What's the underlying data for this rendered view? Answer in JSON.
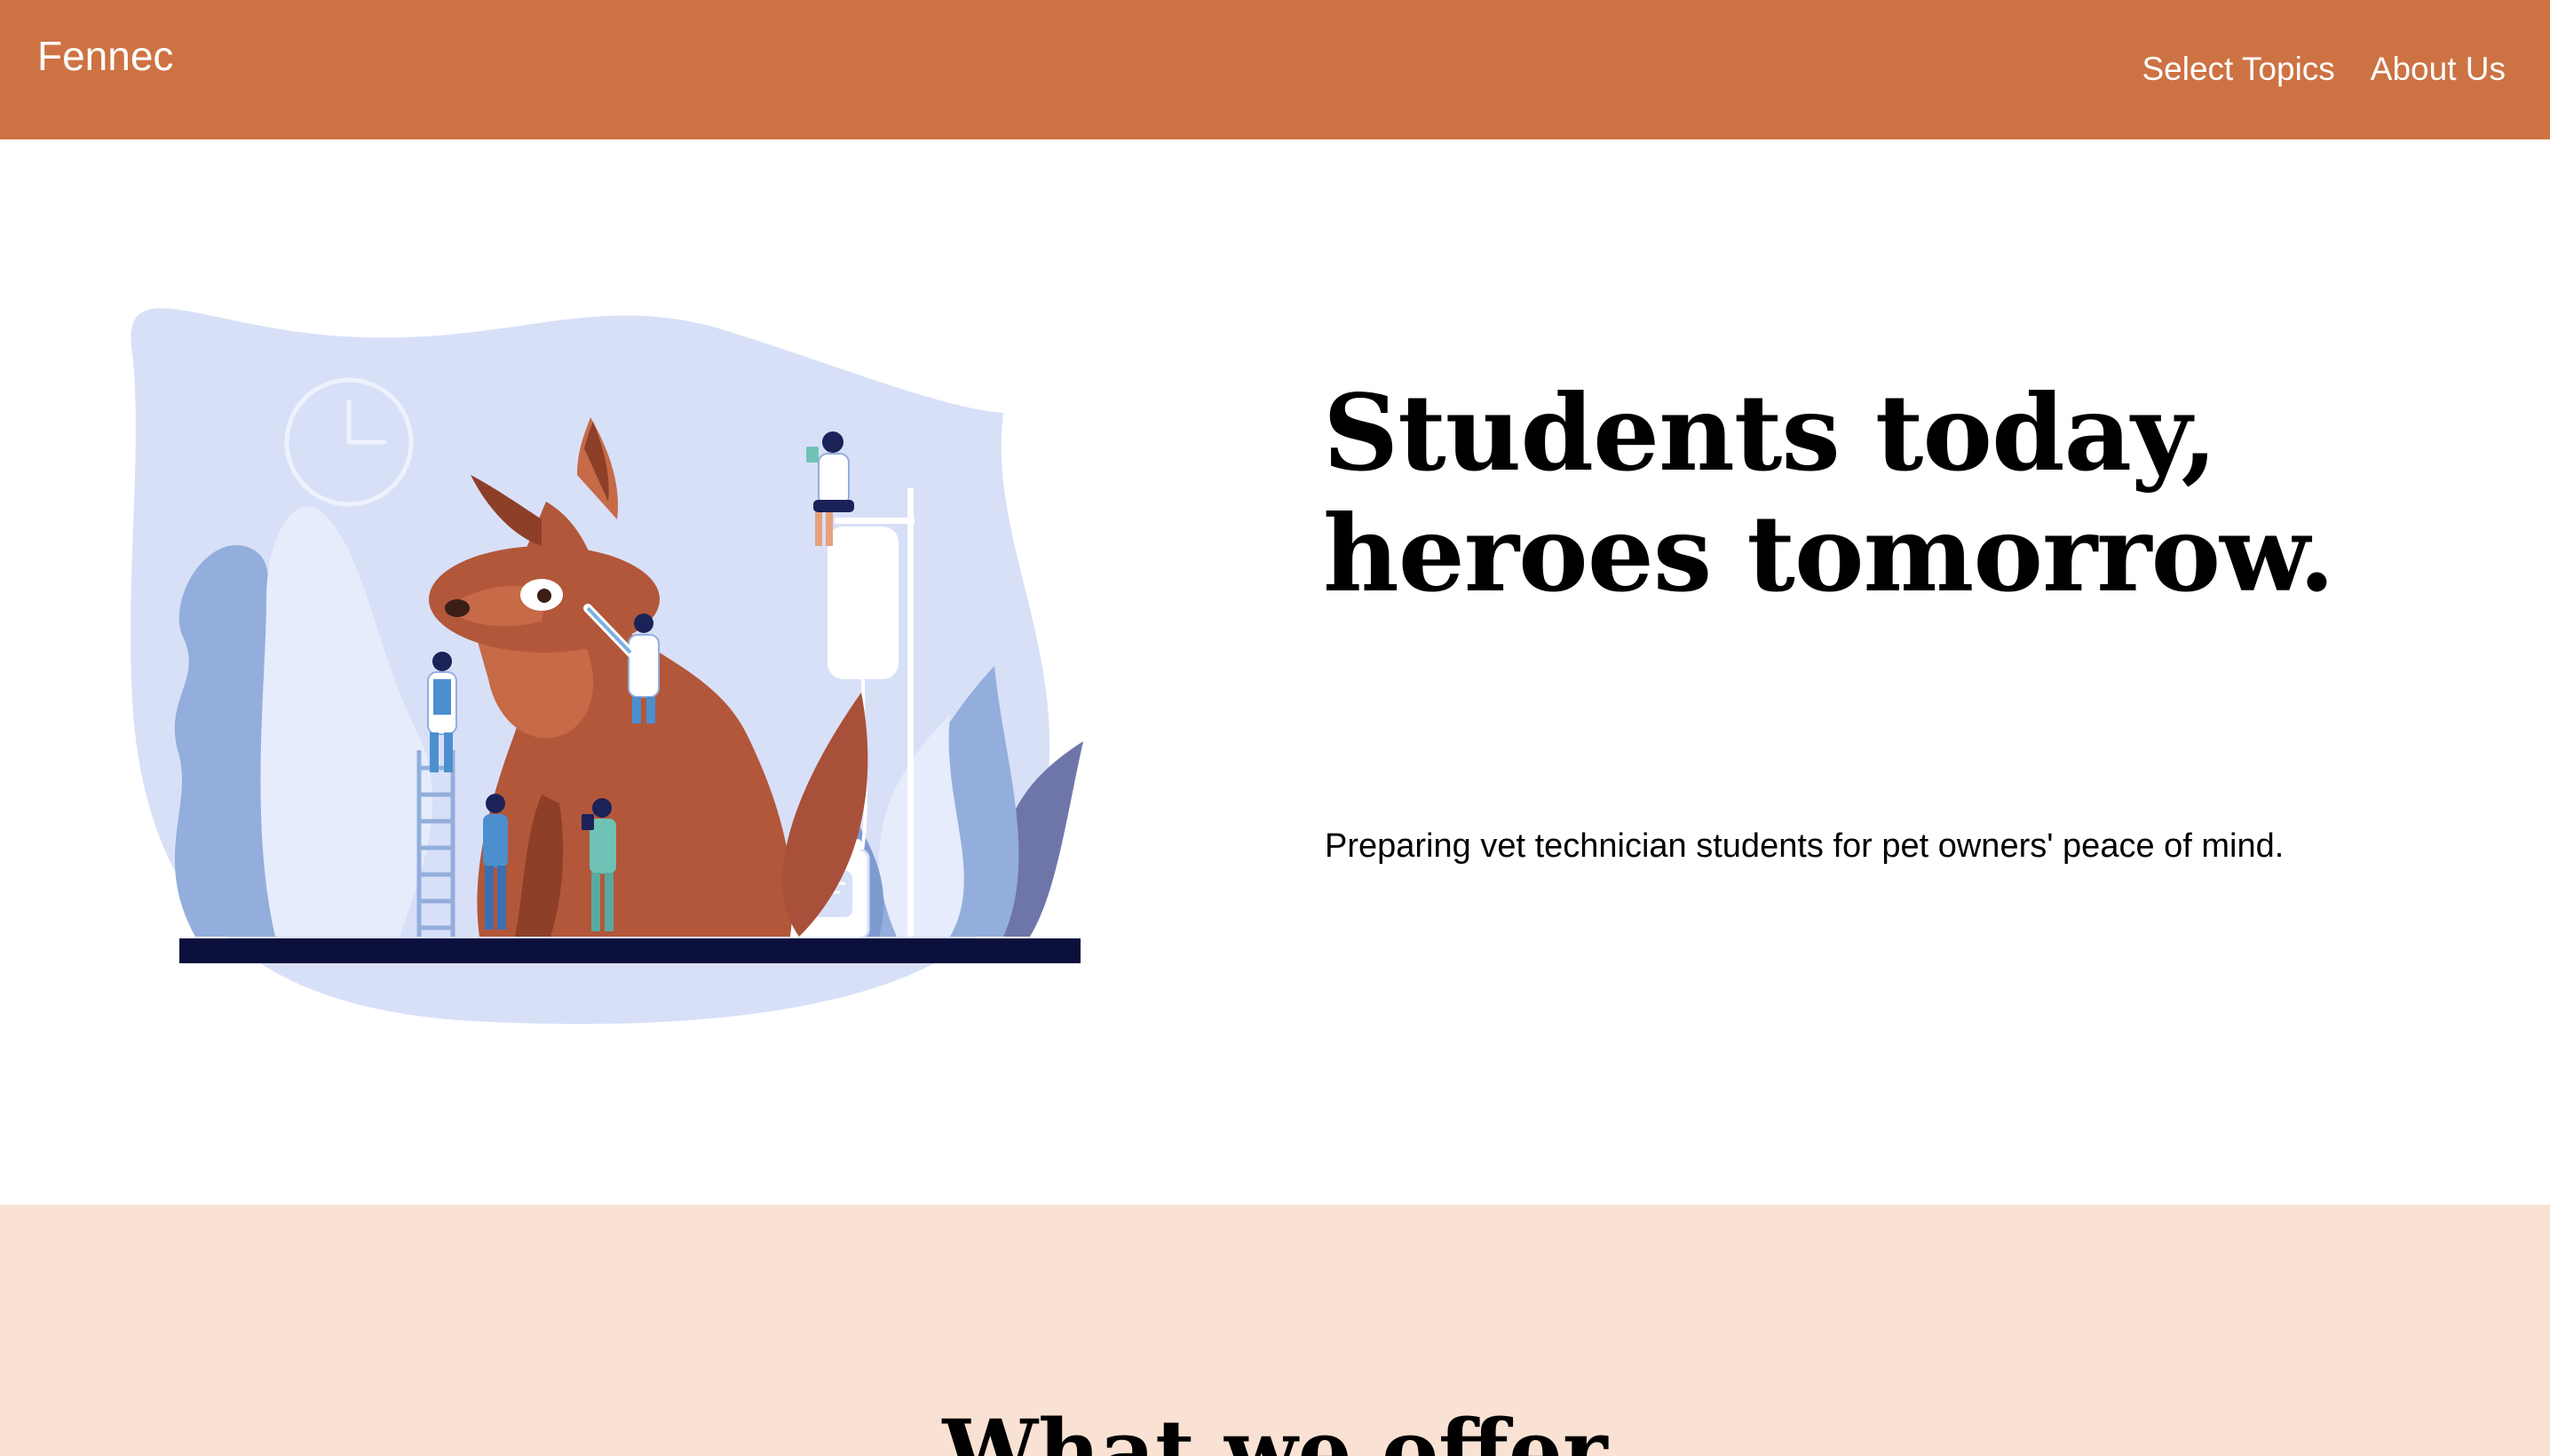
{
  "navbar": {
    "brand": "Fennec",
    "links": [
      "Select Topics",
      "About Us"
    ],
    "color": "#cd7243"
  },
  "hero": {
    "title_line1": "Students today,",
    "title_line2": "heroes tomorrow.",
    "subtitle": "Preparing vet technician students for pet owners' peace of mind.",
    "illustration": "veterinary-dog-illustration"
  },
  "offer": {
    "title": "What we offer",
    "background": "#f9e2d3"
  }
}
